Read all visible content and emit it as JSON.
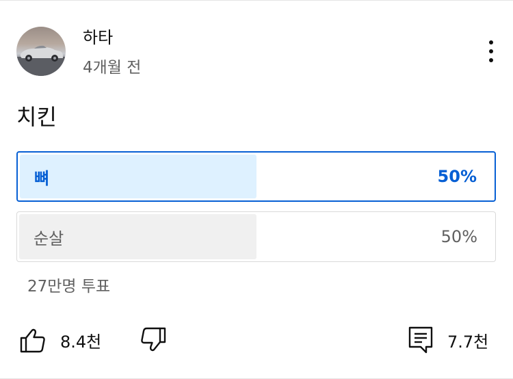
{
  "post": {
    "author": "하타",
    "time": "4개월 전",
    "text": "치킨"
  },
  "poll": {
    "options": [
      {
        "label": "뼈",
        "percent_label": "50%",
        "percent": 50,
        "selected": true
      },
      {
        "label": "순살",
        "percent_label": "50%",
        "percent": 50,
        "selected": false
      }
    ],
    "vote_count": "27만명 투표"
  },
  "actions": {
    "like_count": "8.4천",
    "comment_count": "7.7천"
  },
  "colors": {
    "accent": "#065fd4",
    "selected_fill": "#def1ff",
    "unselected_fill": "#f0f0f0",
    "secondary_text": "#606060"
  },
  "icons": [
    "avatar-car-photo",
    "more-vert-icon",
    "thumbs-up-icon",
    "thumbs-down-icon",
    "comment-icon"
  ]
}
